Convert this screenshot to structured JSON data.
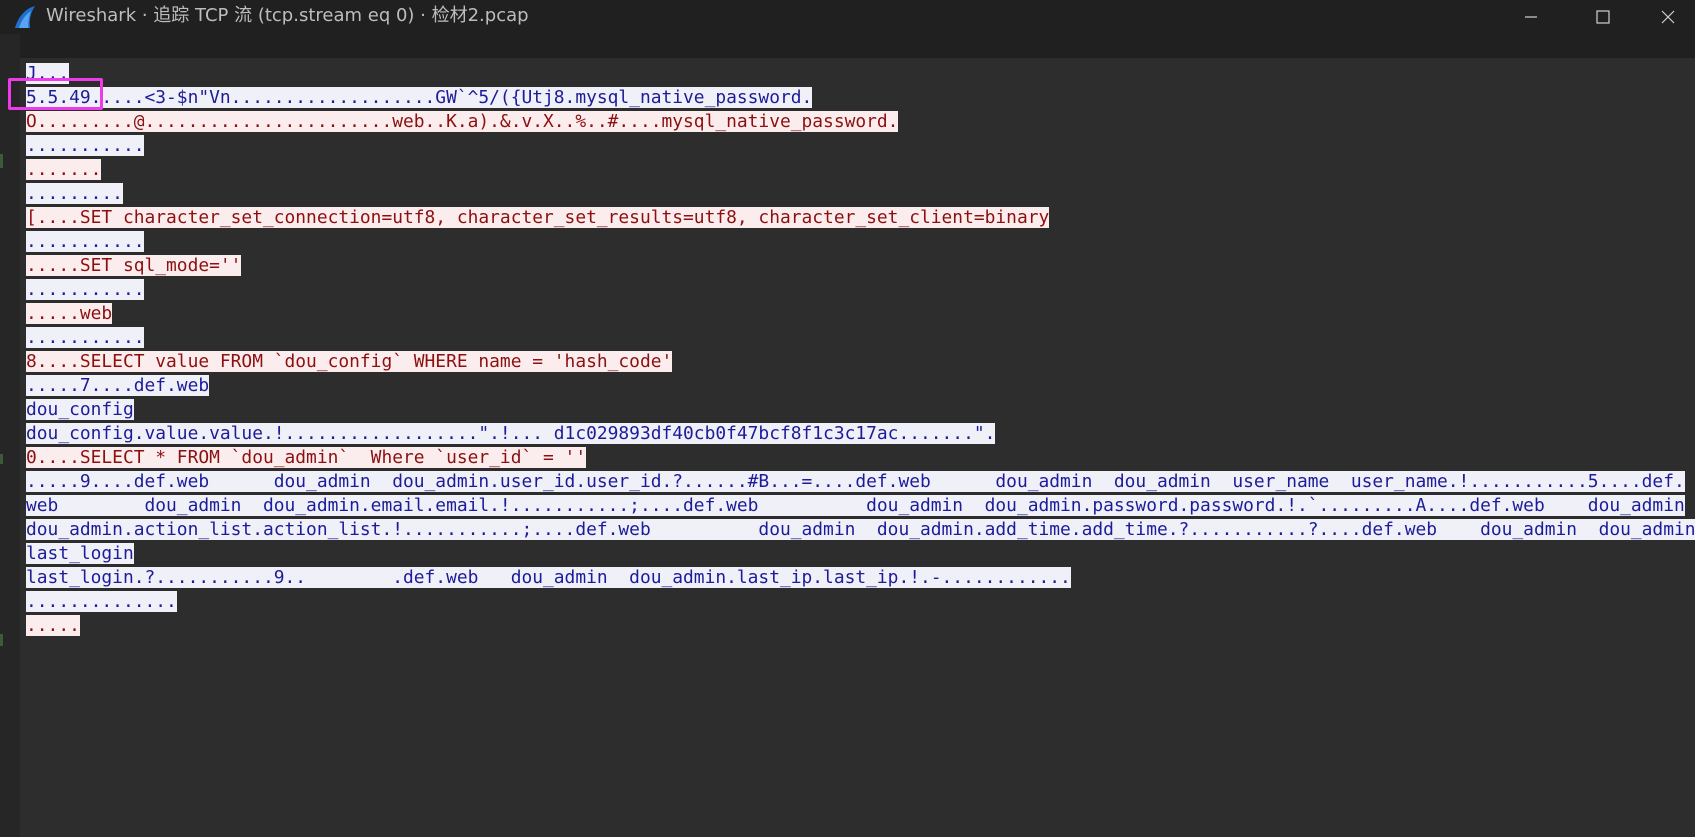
{
  "window": {
    "title": "Wireshark · 追踪 TCP 流 (tcp.stream eq 0) · 检材2.pcap",
    "icon": "wireshark-fin-icon",
    "controls": [
      "minimize-icon",
      "maximize-icon",
      "close-icon"
    ]
  },
  "colors": {
    "client_bg": "#f0f0f8",
    "client_fg": "#1c1c9a",
    "server_bg": "#fbeded",
    "server_fg": "#8c1010",
    "annotation_box": "#ee3be9"
  },
  "stream": {
    "lines": [
      {
        "dir": "client",
        "text": "J..."
      },
      {
        "dir": "client",
        "text": "5.5.49.....<3-$n\"Vn...................GW`^5/({Utj8.mysql_native_password."
      },
      {
        "dir": "server",
        "text": "O.........@.......................web..K.a).&.v.X..%..#....mysql_native_password."
      },
      {
        "dir": "client",
        "text": "..........."
      },
      {
        "dir": "server",
        "text": "......."
      },
      {
        "dir": "client",
        "text": "........."
      },
      {
        "dir": "server",
        "text": "[....SET character_set_connection=utf8, character_set_results=utf8, character_set_client=binary"
      },
      {
        "dir": "client",
        "text": "..........."
      },
      {
        "dir": "server",
        "text": ".....SET sql_mode=''"
      },
      {
        "dir": "client",
        "text": "..........."
      },
      {
        "dir": "server",
        "text": ".....web"
      },
      {
        "dir": "client",
        "text": "..........."
      },
      {
        "dir": "server",
        "text": "8....SELECT value FROM `dou_config` WHERE name = 'hash_code'"
      },
      {
        "dir": "client",
        "text": ".....7....def.web"
      },
      {
        "dir": "client",
        "text": "dou_config"
      },
      {
        "dir": "client",
        "text": "dou_config.value.value.!..................\".!... d1c029893df40cb0f47bcf8f1c3c17ac.......\"."
      },
      {
        "dir": "server",
        "text": "0....SELECT * FROM `dou_admin`  Where `user_id` = ''"
      },
      {
        "dir": "client",
        "text": ".....9....def.web      dou_admin  dou_admin.user_id.user_id.?......#B...=....def.web      dou_admin  dou_admin  user_name  user_name.!...........5....def."
      },
      {
        "dir": "client",
        "text": "web        dou_admin  dou_admin.email.email.!...........;....def.web          dou_admin  dou_admin.password.password.!.`.........A....def.web    dou_admin"
      },
      {
        "dir": "client",
        "text": "dou_admin.action_list.action_list.!...........;....def.web          dou_admin  dou_admin.add_time.add_time.?...........?....def.web    dou_admin  dou_admin"
      },
      {
        "dir": "client",
        "text": "last_login"
      },
      {
        "dir": "client",
        "text": "last_login.?...........9..        .def.web   dou_admin  dou_admin.last_ip.last_ip.!.-............"
      },
      {
        "dir": "client",
        "text": ".............."
      },
      {
        "dir": "server",
        "text": "....."
      }
    ]
  }
}
